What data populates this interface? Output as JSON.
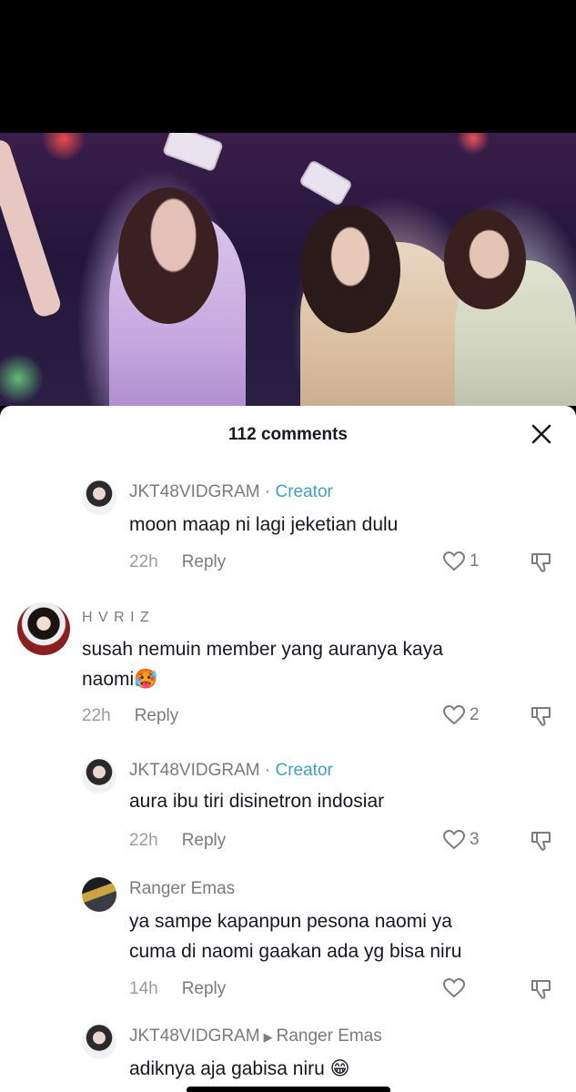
{
  "sheet": {
    "title": "112 comments"
  },
  "comments": [
    {
      "username": "JKT48VIDGRAM",
      "separator": "·",
      "badge": "Creator",
      "text_lines": [
        "moon maap ni lagi jeketian dulu"
      ],
      "time": "22h",
      "reply_label": "Reply",
      "likes": "1",
      "is_reply": true
    },
    {
      "username": "H V R I Z",
      "text_lines": [
        "susah nemuin member yang auranya kaya",
        "naomi🥵"
      ],
      "time": "22h",
      "reply_label": "Reply",
      "likes": "2",
      "is_reply": false
    },
    {
      "username": "JKT48VIDGRAM",
      "separator": "·",
      "badge": "Creator",
      "text_lines": [
        "aura ibu tiri disinetron indosiar"
      ],
      "time": "22h",
      "reply_label": "Reply",
      "likes": "3",
      "is_reply": true
    },
    {
      "username": "Ranger Emas",
      "text_lines": [
        "ya sampe kapanpun pesona naomi ya",
        "cuma di naomi gaakan ada yg bisa niru"
      ],
      "time": "14h",
      "reply_label": "Reply",
      "likes": "",
      "is_reply": true
    },
    {
      "username": "JKT48VIDGRAM",
      "reply_to_arrow": "▶",
      "reply_to": "Ranger Emas",
      "text_lines": [
        "adiknya aja gabisa niru 😁"
      ],
      "is_reply": true
    }
  ],
  "icons": {
    "close": "close-icon",
    "like": "heart-outline-icon",
    "dislike": "thumbs-down-icon"
  },
  "colors": {
    "creator_badge": "#3fa0c4",
    "text_primary": "#161823",
    "text_secondary": "#7a7a80"
  }
}
